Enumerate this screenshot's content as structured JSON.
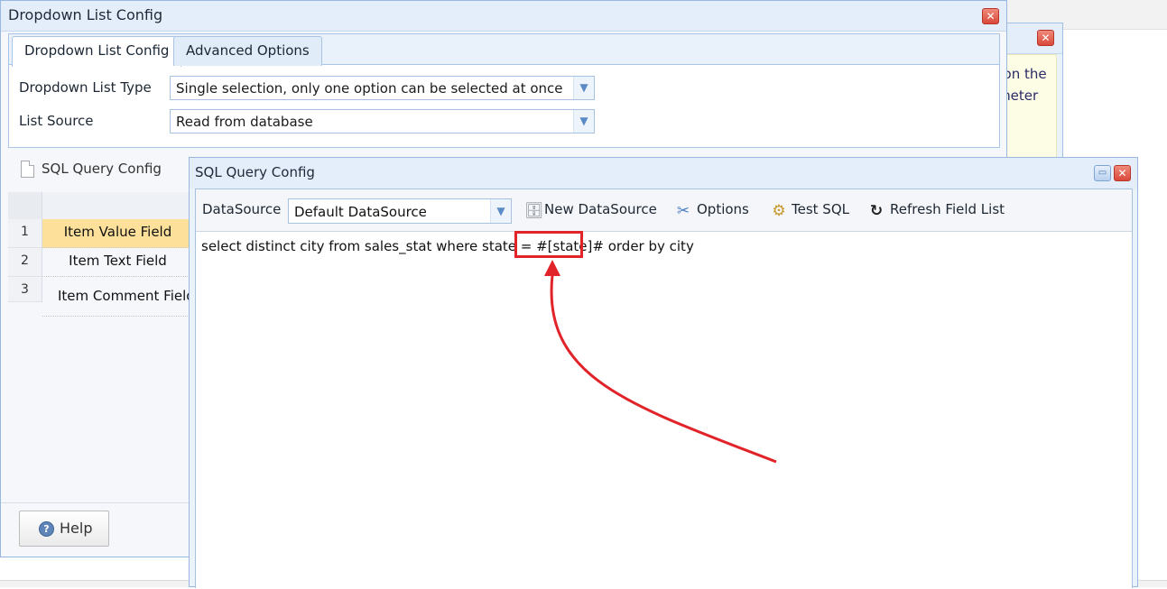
{
  "main_dialog": {
    "title": "Dropdown List Config",
    "tabs": [
      "Dropdown List Config",
      "Advanced Options"
    ],
    "fields": {
      "list_type_label": "Dropdown List Type",
      "list_type_value": "Single selection, only one option can be selected at once",
      "list_source_label": "List Source",
      "list_source_value": "Read from database"
    },
    "sql_section_label": "SQL Query Config",
    "grid_rows": [
      {
        "num": "1",
        "field": "Item Value Field"
      },
      {
        "num": "2",
        "field": "Item Text Field"
      },
      {
        "num": "3",
        "field": "Item Comment Field"
      }
    ],
    "help_label": "Help"
  },
  "back_window": {
    "text_lines": [
      "Click on the",
      "parameter"
    ]
  },
  "sql_dialog": {
    "title": "SQL Query Config",
    "datasource_label": "DataSource",
    "datasource_value": "Default DataSource",
    "buttons": {
      "new_datasource": "New DataSource",
      "options": "Options",
      "test_sql": "Test SQL",
      "refresh": "Refresh Field List"
    },
    "sql": "select distinct city from sales_stat where state = #[state]# order by city"
  },
  "colors": {
    "annotation": "#e1232a",
    "selected_row": "#fde19b",
    "window_border": "#98b8e0"
  },
  "icons": {
    "close": "✕",
    "maximize": "▭",
    "dropdown": "▼",
    "help": "?",
    "database": "🗄",
    "options": "✂",
    "test_sql": "⚙",
    "refresh": "↻"
  }
}
